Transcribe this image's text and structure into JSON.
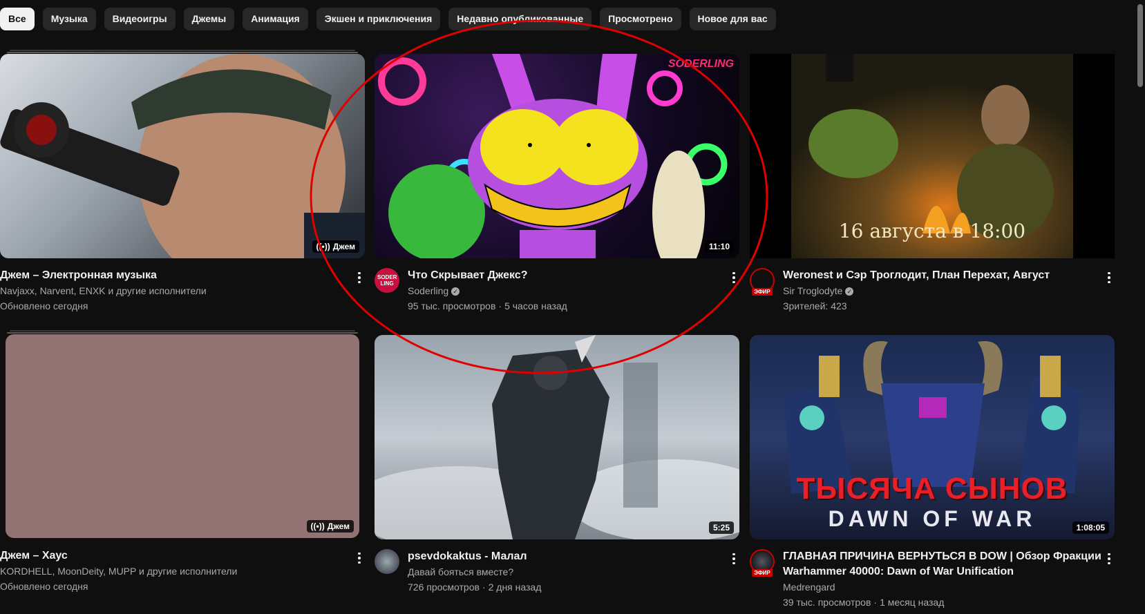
{
  "chips": [
    "Все",
    "Музыка",
    "Видеоигры",
    "Джемы",
    "Анимация",
    "Экшен и приключения",
    "Недавно опубликованные",
    "Просмотрено",
    "Новое для вас"
  ],
  "colors": {
    "background": "#0f0f0f",
    "chip": "#272727",
    "chip_active": "#f1f1f1",
    "annotation": "#e10000"
  },
  "cards": [
    {
      "title": "Джем – Электронная музыка",
      "line1": "Navjaxx, Narvent, ENXK и другие исполнители",
      "line2": "Обновлено сегодня",
      "badge": "Джем",
      "badge_icon": "broadcast-icon"
    },
    {
      "title": "Что Скрывает Джекс?",
      "channel": "Soderling",
      "views": "95 тыс. просмотров",
      "time": "5 часов назад",
      "badge": "11:10",
      "thumb_logo": "SODERLING",
      "avatar_text": "SODER LING"
    },
    {
      "title": "Weronest и Сэр Троглодит, План Перехат, Август",
      "channel": "Sir Troglodyte",
      "views": "Зрителей: 423",
      "live": "ЭФИР",
      "thumb_caption": "16 августа в 18:00"
    },
    {
      "title": "Джем – Хаус",
      "line1": "KORDHELL, MoonDeity, MUPP и другие исполнители",
      "line2": "Обновлено сегодня",
      "badge": "Джем",
      "badge_icon": "broadcast-icon"
    },
    {
      "title": "psevdokaktus - Малал",
      "channel": "Давай бояться вместе?",
      "views": "726 просмотров",
      "time": "2 дня назад",
      "badge": "5:25"
    },
    {
      "title_line1": "ГЛАВНАЯ ПРИЧИНА ВЕРНУТЬСЯ В DOW | Обзор Фракции",
      "title_line2": "Warhammer 40000: Dawn of War Unification",
      "channel": "Medrengard",
      "views": "39 тыс. просмотров",
      "time": "1 месяц назад",
      "badge": "1:08:05",
      "live": "ЭФИР",
      "thumb_title": "ТЫСЯЧА СЫНОВ",
      "thumb_subtitle": "DAWN OF WAR"
    }
  ]
}
